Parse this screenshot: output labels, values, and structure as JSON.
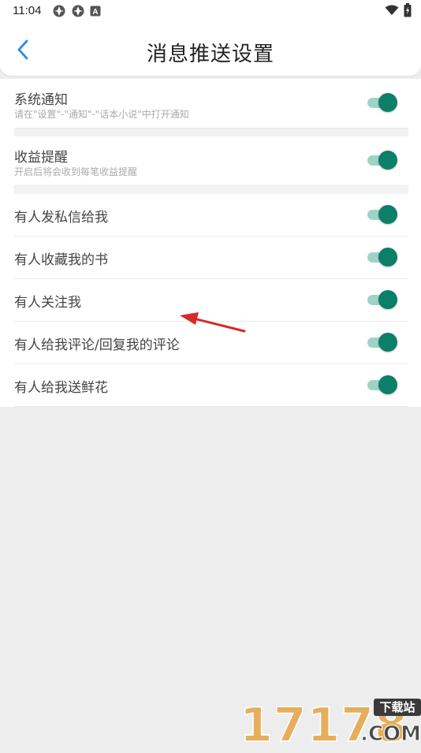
{
  "status_bar": {
    "time": "11:04",
    "icons": [
      "app-icon-1",
      "app-icon-2",
      "a-icon",
      "wifi-icon",
      "battery-icon"
    ]
  },
  "header": {
    "title": "消息推送设置",
    "back_icon": "chevron-left-icon"
  },
  "accent_color": "#0b7f67",
  "accent_track_color": "#9fd3c7",
  "settings": [
    {
      "title": "系统通知",
      "subtitle": "请在\"设置\"-\"通知\"-\"话本小说\"中打开通知",
      "enabled": true
    },
    {
      "title": "收益提醒",
      "subtitle": "开启后将会收到每笔收益提醒",
      "enabled": true
    },
    {
      "title": "有人发私信给我",
      "enabled": true
    },
    {
      "title": "有人收藏我的书",
      "enabled": true
    },
    {
      "title": "有人关注我",
      "enabled": true
    },
    {
      "title": "有人给我评论/回复我的评论",
      "enabled": true
    },
    {
      "title": "有人给我送鲜花",
      "enabled": true
    }
  ],
  "watermark": {
    "digits": "17178",
    "badge": "下载站",
    "domain": ".COM"
  }
}
